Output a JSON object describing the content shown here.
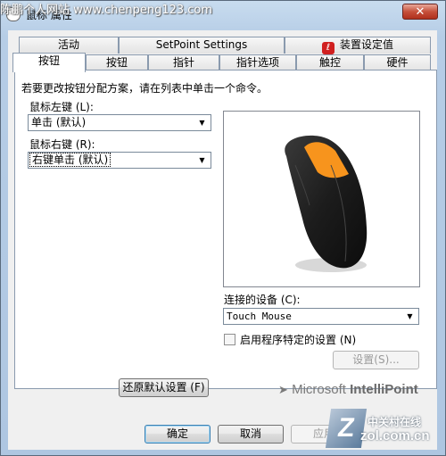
{
  "watermark": "陈鹏个人网站 www.chenpeng123.com",
  "window": {
    "title": "鼠标 属性",
    "close_glyph": "✕"
  },
  "tabs_row1": [
    {
      "label": "活动"
    },
    {
      "label": "SetPoint Settings"
    },
    {
      "label": "装置设定值",
      "icon": "logitech-icon"
    }
  ],
  "tabs_row2": [
    {
      "label": "按钮",
      "active": true
    },
    {
      "label": "按钮"
    },
    {
      "label": "指针"
    },
    {
      "label": "指针选项"
    },
    {
      "label": "触控"
    },
    {
      "label": "硬件"
    }
  ],
  "buttons_tab": {
    "instruction": "若要更改按钮分配方案，请在列表中单击一个命令。",
    "left_label": "鼠标左键 (L):",
    "left_value": "单击 (默认)",
    "right_label": "鼠标右键 (R):",
    "right_value": "右键单击 (默认)",
    "device_label": "连接的设备 (C):",
    "device_value": "Touch Mouse",
    "app_settings_checkbox": "启用程序特定的设置 (N)",
    "app_settings_checked": false,
    "settings_button": "设置(S)...",
    "restore_button": "还原默认设置 (F)",
    "logo_prefix": "Microsoft",
    "logo_brand": "IntelliPoint"
  },
  "footer": {
    "ok": "确定",
    "cancel": "取消",
    "apply": "应用"
  },
  "zol": {
    "mark": "Z",
    "name": "中关村在线",
    "domain": "zol.com.cn"
  },
  "colors": {
    "mouse_body": "#1c1c1c",
    "mouse_accent": "#f7941d"
  }
}
